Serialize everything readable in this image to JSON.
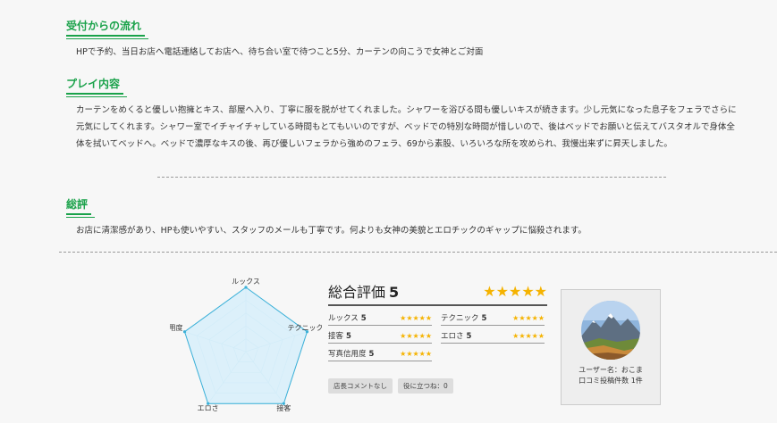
{
  "sections": [
    {
      "title": "受付からの流れ",
      "text": "HPで予約、当日お店へ電話連絡してお店へ、待ち合い室で待つこと5分、カーテンの向こうで女神とご対面"
    },
    {
      "title": "プレイ内容",
      "text": "カーテンをめくると優しい抱擁とキス、部屋へ入り、丁寧に服を脱がせてくれました。シャワーを浴びる間も優しいキスが続きます。少し元気になった息子をフェラでさらに元気にしてくれます。シャワー室でイチャイチャしている時間もとてもいいのですが、ベッドでの特別な時間が惜しいので、後はベッドでお願いと伝えてバスタオルで身体全体を拭いてベッドへ。ベッドで濃厚なキスの後、再び優しいフェラから強めのフェラ、69から素股、いろいろな所を攻められ、我慢出来ずに昇天しました。"
    },
    {
      "title": "総評",
      "text": "お店に清潔感があり、HPも使いやすい、スタッフのメールも丁寧です。何よりも女神の美貌とエロチックのギャップに悩殺されます。"
    }
  ],
  "radar": {
    "labels": [
      "ルックス",
      "テクニック",
      "接客",
      "エロさ",
      "写真信用度"
    ],
    "values": [
      5,
      5,
      5,
      5,
      5
    ],
    "max": 5
  },
  "score": {
    "overall_label": "総合評価",
    "overall_value": "5",
    "overall_stars": "★★★★★",
    "items": [
      {
        "label": "ルックス",
        "value": "5",
        "stars": "★★★★★"
      },
      {
        "label": "テクニック",
        "value": "5",
        "stars": "★★★★★"
      },
      {
        "label": "接客",
        "value": "5",
        "stars": "★★★★★"
      },
      {
        "label": "エロさ",
        "value": "5",
        "stars": "★★★★★"
      },
      {
        "label": "写真信用度",
        "value": "5",
        "stars": "★★★★★"
      }
    ]
  },
  "badges": {
    "shop_comment": "店長コメントなし",
    "helpful": "役に立つね：0"
  },
  "user": {
    "name_line": "ユーザー名：おこま",
    "posts_line": "口コミ投稿件数 1件"
  },
  "colors": {
    "accent": "#1aa24a",
    "star": "#f5b301",
    "radar_fill": "#d4eefa",
    "radar_stroke": "#3ab0d8"
  }
}
